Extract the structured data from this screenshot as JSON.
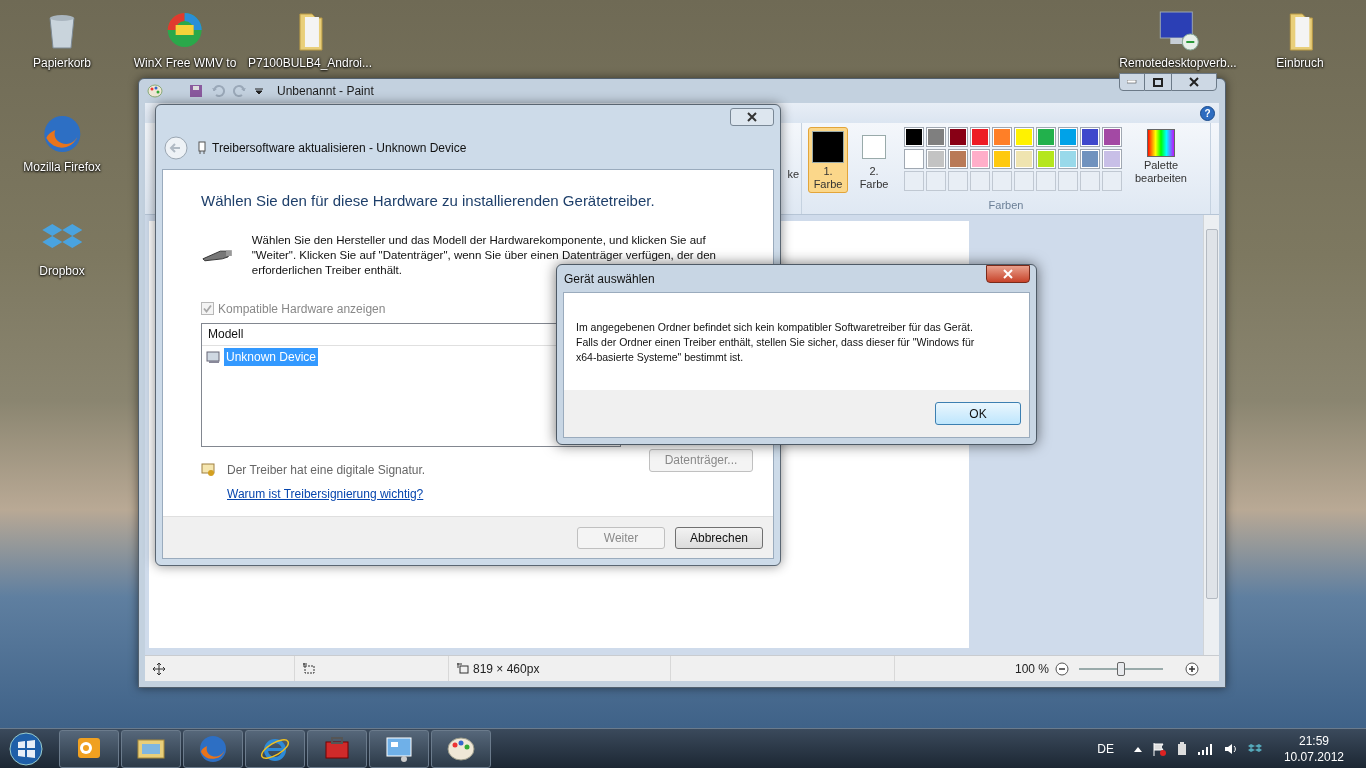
{
  "desktop_icons": [
    {
      "kind": "recycle-bin",
      "label": "Papierkorb"
    },
    {
      "kind": "app",
      "label": "WinX Free WMV to"
    },
    {
      "kind": "folder",
      "label": "P7100BULB4_Androi..."
    },
    {
      "kind": "firefox",
      "label": "Mozilla Firefox"
    },
    {
      "kind": "dropbox",
      "label": "Dropbox"
    },
    {
      "kind": "remote",
      "label": "Remotedesktopverb..."
    },
    {
      "kind": "folder",
      "label": "Einbruch"
    }
  ],
  "paint": {
    "title": "Unbenannt - Paint",
    "ribbon_cut_label": "ke",
    "current_colors": [
      {
        "label": "1. Farbe",
        "color": "#000000",
        "selected": true
      },
      {
        "label": "2. Farbe",
        "color": "#ffffff",
        "selected": false
      }
    ],
    "palette": [
      {
        "color": "#000000"
      },
      {
        "color": "#7f7f7f"
      },
      {
        "color": "#880015"
      },
      {
        "color": "#ed1c24"
      },
      {
        "color": "#ff7f27"
      },
      {
        "color": "#fff200"
      },
      {
        "color": "#22b14c"
      },
      {
        "color": "#00a2e8"
      },
      {
        "color": "#3f48cc"
      },
      {
        "color": "#a349a4"
      },
      {
        "color": "#ffffff"
      },
      {
        "color": "#c3c3c3"
      },
      {
        "color": "#b97a57"
      },
      {
        "color": "#ffaec9"
      },
      {
        "color": "#ffc90e"
      },
      {
        "color": "#efe4b0"
      },
      {
        "color": "#b5e61d"
      },
      {
        "color": "#99d9ea"
      },
      {
        "color": "#7092be"
      },
      {
        "color": "#c8bfe7"
      }
    ],
    "edit_palette_label": "Palette bearbeiten",
    "help_glyph": "?",
    "group_label": "Farben",
    "status_bar": {
      "image_size": "819 × 460px",
      "zoom": "100 %",
      "zoom_slider": {
        "level": 0.5
      }
    }
  },
  "driver_window": {
    "title": "Treibersoftware aktualisieren - Unknown Device",
    "heading": "Wählen Sie den für diese Hardware zu installierenden Gerätetreiber.",
    "description": "Wählen Sie den Hersteller und das Modell der Hardwarekomponente, und klicken Sie auf \"Weiter\". Klicken Sie auf \"Datenträger\", wenn Sie über einen Datenträger verfügen, der den erforderlichen Treiber enthält.",
    "checkbox": {
      "label": "Kompatible Hardware anzeigen",
      "checked": true,
      "disabled": true
    },
    "list": {
      "column": "Modell",
      "items": [
        {
          "label": "Unknown Device",
          "selected": true
        }
      ]
    },
    "signature_text": "Der Treiber hat eine digitale Signatur.",
    "link": "Warum ist Treibersignierung wichtig?",
    "disk_button": {
      "label": "Datenträger...",
      "disabled": true
    },
    "buttons": [
      {
        "label": "Weiter",
        "disabled": true
      },
      {
        "label": "Abbrechen",
        "disabled": false
      }
    ]
  },
  "dialog": {
    "title": "Gerät auswählen",
    "message": "Im angegebenen Ordner befindet sich kein kompatibler Softwaretreiber für das Gerät. Falls der Ordner einen Treiber enthält, stellen Sie sicher, dass dieser für \"Windows für x64-basierte Systeme\" bestimmt ist.",
    "button": "OK"
  },
  "taskbar": {
    "apps": [
      {
        "kind": "outlook"
      },
      {
        "kind": "explorer"
      },
      {
        "kind": "firefox"
      },
      {
        "kind": "ie"
      },
      {
        "kind": "toolbox"
      },
      {
        "kind": "control-panel"
      },
      {
        "kind": "paint"
      }
    ],
    "language": "DE",
    "time": "21:59",
    "date": "10.07.2012"
  }
}
